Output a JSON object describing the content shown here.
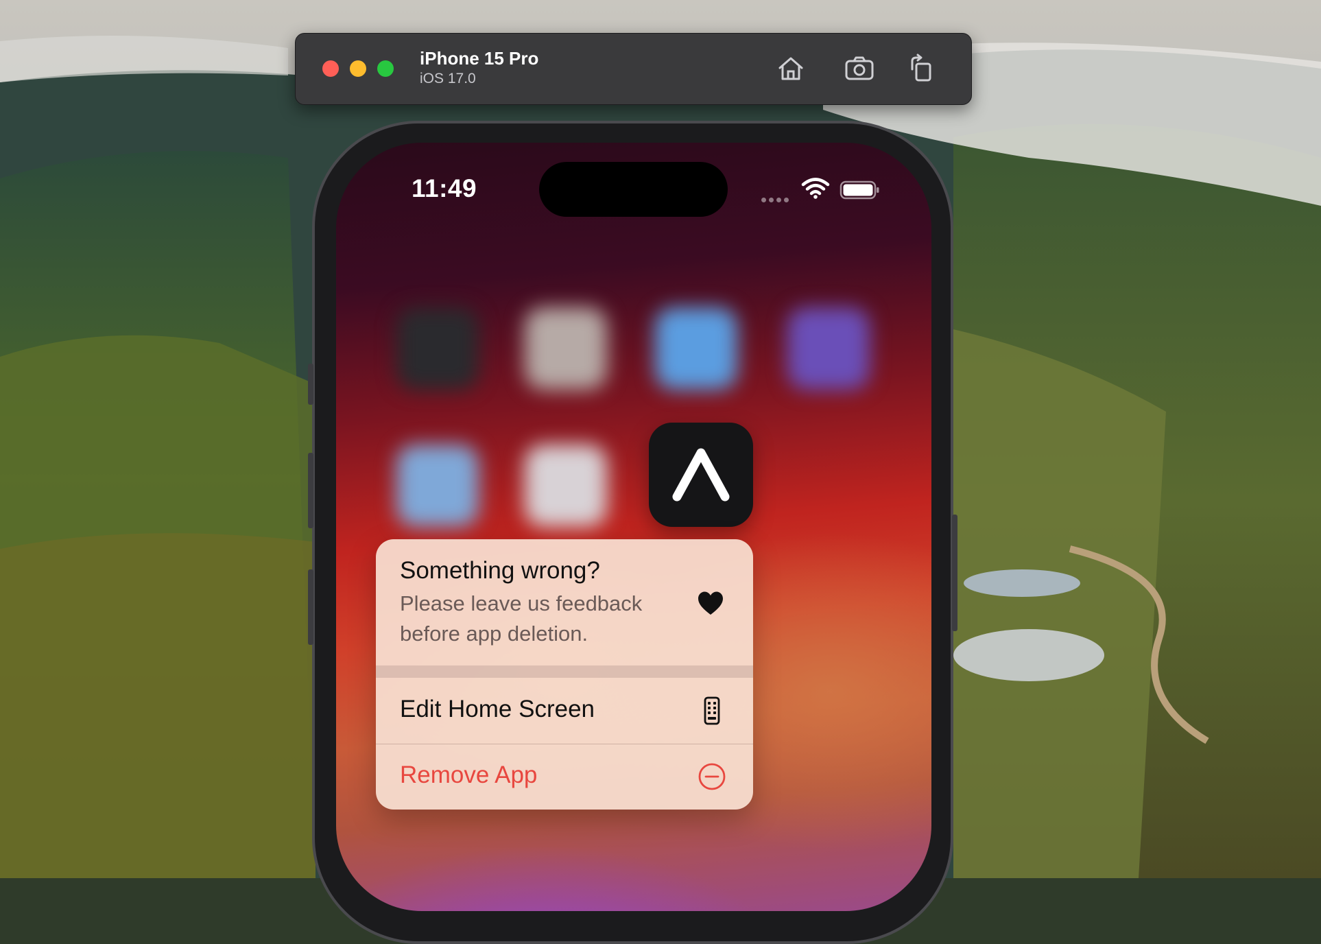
{
  "simulator": {
    "device_name": "iPhone 15 Pro",
    "os_version": "iOS 17.0",
    "toolbar_buttons": [
      {
        "name": "home",
        "icon": "house-icon"
      },
      {
        "name": "screenshot",
        "icon": "camera-icon"
      },
      {
        "name": "rotate",
        "icon": "rotate-icon"
      }
    ],
    "traffic_lights": {
      "close": "#ff5f57",
      "minimize": "#febc2e",
      "zoom": "#28c840"
    }
  },
  "status_bar": {
    "time": "11:49",
    "icons": [
      "cellular-signal-icon",
      "wifi-icon",
      "battery-icon"
    ]
  },
  "focused_app": {
    "icon": "caret-up-icon",
    "background": "#151517"
  },
  "context_menu": {
    "feedback": {
      "title": "Something wrong?",
      "description": "Please leave us feedback before app deletion.",
      "icon": "heart-icon"
    },
    "items": [
      {
        "label": "Edit Home Screen",
        "icon": "phone-icon",
        "destructive": false
      },
      {
        "label": "Remove App",
        "icon": "minus-circle-icon",
        "destructive": true
      }
    ],
    "destructive_color": "#e8473f"
  }
}
